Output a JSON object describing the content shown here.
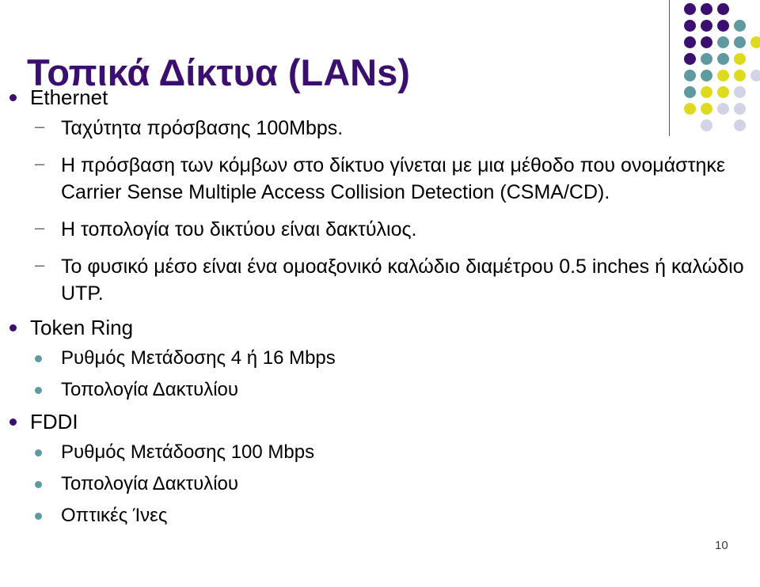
{
  "slide": {
    "title": "Τοπικά Δίκτυα  (LANs)",
    "page_number": "10",
    "colors": {
      "title_purple": "#3B0F6F",
      "bullet_purple": "#3B0F6F",
      "bullet_teal": "#5E9AA0",
      "dash_gray": "#6E6E78",
      "body_text": "#000000",
      "divider": "#55555D",
      "dot_dark_purple": "#3B0F6F",
      "dot_teal": "#5E9AA0",
      "dot_yellow": "#DEDB1E",
      "dot_lavender": "#D2D3E6"
    },
    "body": [
      {
        "level": 1,
        "marker": "disc-purple",
        "text": "Ethernet"
      },
      {
        "level": 2,
        "marker": "dash",
        "text": "Ταχύτητα πρόσβασης 100Mbps."
      },
      {
        "level": 2,
        "marker": "dash",
        "text": "Η πρόσβαση των κόμβων στο δίκτυο γίνεται με μια μέθοδο που ονομάστηκε Carrier Sense Multiple Access Collision Detection (CSMA/CD)."
      },
      {
        "level": 2,
        "marker": "dash",
        "text": "Η τοπολογία του δικτύου είναι δακτύλιος."
      },
      {
        "level": 2,
        "marker": "dash",
        "text": "Το φυσικό μέσο είναι ένα ομοαξονικό καλώδιο διαμέτρου 0.5 inches ή καλώδιο UTP."
      },
      {
        "level": 1,
        "marker": "disc-purple",
        "text": "Token Ring"
      },
      {
        "level": 2,
        "marker": "disc-teal",
        "text": "Ρυθμός Μετάδοσης 4 ή 16 Mbps"
      },
      {
        "level": 2,
        "marker": "disc-teal",
        "text": "Τοπολογία Δακτυλίου"
      },
      {
        "level": 1,
        "marker": "disc-purple",
        "text": "FDDI"
      },
      {
        "level": 2,
        "marker": "disc-teal",
        "text": "Ρυθμός Μετάδοσης 100 Mbps"
      },
      {
        "level": 2,
        "marker": "disc-teal",
        "text": "Τοπολογία Δακτυλίου"
      },
      {
        "level": 2,
        "marker": "disc-teal",
        "text": "Οπτικές Ίνες"
      }
    ],
    "dash_glyph": "–",
    "decoration": {
      "dot_grid_rows": [
        [
          "dark",
          "dark",
          "dark",
          "none",
          "none"
        ],
        [
          "dark",
          "dark",
          "dark",
          "teal",
          "none"
        ],
        [
          "dark",
          "dark",
          "teal",
          "teal",
          "yellow"
        ],
        [
          "dark",
          "teal",
          "teal",
          "yellow",
          "none"
        ],
        [
          "teal",
          "teal",
          "yellow",
          "yellow",
          "lavender"
        ],
        [
          "teal",
          "yellow",
          "yellow",
          "lavender",
          "none"
        ],
        [
          "yellow",
          "yellow",
          "lavender",
          "lavender",
          "none"
        ],
        [
          "none",
          "lavender",
          "none",
          "lavender",
          "none"
        ]
      ]
    }
  }
}
